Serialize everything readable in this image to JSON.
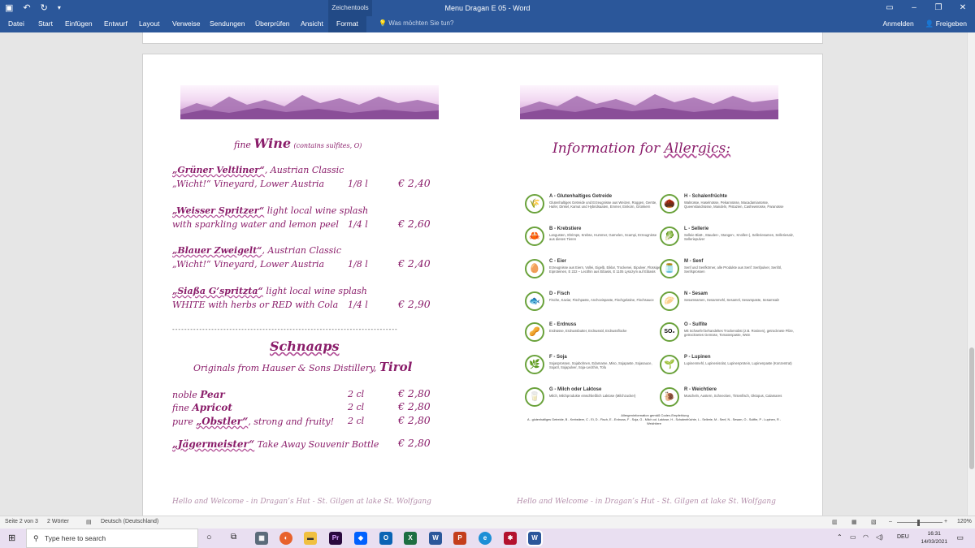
{
  "titlebar": {
    "tools_label": "Zeichentools",
    "doc_title": "Menu Dragan E 05 - Word"
  },
  "ribbon": {
    "tabs": [
      "Datei",
      "Start",
      "Einfügen",
      "Entwurf",
      "Layout",
      "Verweise",
      "Sendungen",
      "Überprüfen",
      "Ansicht",
      "Format"
    ],
    "tellme": "Was möchten Sie tun?",
    "signin": "Anmelden",
    "share": "Freigeben"
  },
  "menu": {
    "wine_heading_prefix": "fine",
    "wine_heading_word": "Wine",
    "wine_heading_suffix": "(contains sulfites, O)",
    "wines": [
      {
        "line1_bold": "„Grüner Veltliner“",
        "line1_rest": ", Austrian Classic",
        "line2": "„Wicht!“ Vineyard, Lower Austria",
        "qty": "1/8 l",
        "price": "€ 2,40"
      },
      {
        "line1_bold": "„Weisser Spritzer“",
        "line1_rest": " light local wine splash",
        "line2": "with sparkling water and lemon peel",
        "qty": "1/4 l",
        "price": "€ 2,60"
      },
      {
        "line1_bold": "„Blauer Zweigelt“",
        "line1_rest": ", Austrian Classic",
        "line2": "„Wicht!“ Vineyard, Lower Austria",
        "qty": "1/8 l",
        "price": "€ 2,40"
      },
      {
        "line1_bold": "„Siaßa G’spritzta“",
        "line1_rest": " light local wine splash",
        "line2": "WHITE with herbs or RED with Cola",
        "qty": "1/4 l",
        "price": "€ 2,90"
      }
    ],
    "divider": "---------------------------------------------------------------------------",
    "schnaaps_heading": "Schnaaps",
    "schnaaps_sub_prefix": "Originals from Hauser & Sons Distillery,",
    "schnaaps_sub_word": "Tirol",
    "schnaaps": [
      {
        "prefix": "noble",
        "bold": "Pear",
        "rest": "",
        "qty": "2 cl",
        "price": "€ 2,80"
      },
      {
        "prefix": "fine",
        "bold": "Apricot",
        "rest": "",
        "qty": "2 cl",
        "price": "€ 2,80"
      },
      {
        "prefix": "pure",
        "bold": "„Obstler“",
        "rest": ", strong and fruity!",
        "qty": "2 cl",
        "price": "€ 2,80"
      }
    ],
    "jaeger": {
      "bold": "„Jägermeister“",
      "rest": " Take Away Souvenir Bottle",
      "price": "€ 2,80"
    },
    "footer": "Hello and Welcome - in Dragan’s Hut - St. Gilgen at lake St. Wolfgang"
  },
  "allergy": {
    "heading_prefix": "Information for",
    "heading_word": "Allergics:",
    "left": [
      {
        "icon": "wheat-icon",
        "glyph": "🌾",
        "name": "A - Glutenhaltiges Getreide",
        "desc": "Glutenhaltiges Getreide und Erzeugnisse aus Weizen, Roggen, Gerste, Hafer, Dinkel, Kamut und Hybridsaaten, Emmer, Einkorn, Grünkern"
      },
      {
        "icon": "crab-icon",
        "glyph": "🦀",
        "name": "B - Krebstiere",
        "desc": "Langusten, Shrimps, Krebse, Hummer, Garnelen, Scampi, Erzeugnisse aus diesen Tieren"
      },
      {
        "icon": "egg-icon",
        "glyph": "🥚",
        "name": "C - Eier",
        "desc": "Erzeugnisse aus Eiern, Vollei, Eigelb, Eiklar, Trockenei, Eipulver, Flüssigei, Eiproteinen, E 222 – Lecithin aus Eibasis, E 1105 Lysozym auf Eibasis"
      },
      {
        "icon": "fish-icon",
        "glyph": "🐟",
        "name": "D - Fisch",
        "desc": "Fische, Kaviar, Fischpaste, Anchovispaste, Fischgelatine, Fischsauce"
      },
      {
        "icon": "peanut-icon",
        "glyph": "🥜",
        "name": "E - Erdnuss",
        "desc": "Erdnüsse, Erdnussbutter, Erdnussöl, Erdnussflocke"
      },
      {
        "icon": "soy-icon",
        "glyph": "🌿",
        "name": "F - Soja",
        "desc": "Sojasprossen, Sojabohnen, Edamame, Miso, Sojapaste, Sojasauce, Sojaöl, Sojapulver, Soja-Lecithin, Tofu"
      },
      {
        "icon": "milk-icon",
        "glyph": "🥛",
        "name": "G - Milch oder Laktose",
        "desc": "Milch, Milchprodukte einschließlich Laktose (Milchzucker)"
      }
    ],
    "right": [
      {
        "icon": "nut-icon",
        "glyph": "🌰",
        "name": "H - Schalenfrüchte",
        "desc": "Walnüsse, Haselnüsse, Pekannüsse, Macadamianüsse, Queenslandnüsse, Mandeln, Pistazien, Cashewnüsse, Paranüsse"
      },
      {
        "icon": "celery-icon",
        "glyph": "🥬",
        "name": "L - Sellerie",
        "desc": "Selleie Blatt-, Stauden-, Stangen-, Knollen-), Selleriesamen, Selleriesalz, Selleriepulver"
      },
      {
        "icon": "mustard-icon",
        "glyph": "🫙",
        "name": "M - Senf",
        "desc": "Senf und Senfkörner, alle Produkte aus Senf: Senfpulver, Senföl, Senfsprossen"
      },
      {
        "icon": "sesame-icon",
        "glyph": "🥟",
        "name": "N - Sesam",
        "desc": "Sesamsamen, Sesammehl, Sesamöl, Sesampaste, Sesamsalz"
      },
      {
        "icon": "sulfite-icon",
        "glyph": "SO₂",
        "name": "O - Sulfite",
        "desc": "Mit Schwefel behandeltes Trockenobst (z.B. Rosinen), getrocknete Pilze, getrocknetes Gemüse, Tomatenpaste, Wein"
      },
      {
        "icon": "lupin-icon",
        "glyph": "🌱",
        "name": "P - Lupinen",
        "desc": "Lupinenmehl, Lupinenisolat, Lupinenprotein, Lupinenpaste (Konzentrat)"
      },
      {
        "icon": "snail-icon",
        "glyph": "🐌",
        "name": "R - Weichtiere",
        "desc": "Muscheln, Austern, Schnecken, Tintenfisch, Oktopus, Calamares"
      }
    ],
    "legend_title": "Allergeninformation gemäß Codex-Empfehlung",
    "legend": "A - glutenhaltiges Getreide, B - Krebstiere, C - Ei, D - Fisch, E - Erdnuss, F - Soja, G - Milch od. Laktose, H - Schalenfrüchte, L - Sellerie, M - Senf, N - Sesam, O - Sulfite, P - Lupinen, R - Weichtiere"
  },
  "statusbar": {
    "page": "Seite 2 von 3",
    "words": "2 Wörter",
    "language": "Deutsch (Deutschland)",
    "zoom": "120%"
  },
  "taskbar": {
    "search_placeholder": "Type here to search",
    "lang": "DEU",
    "time": "16:31",
    "date": "14/03/2021"
  }
}
